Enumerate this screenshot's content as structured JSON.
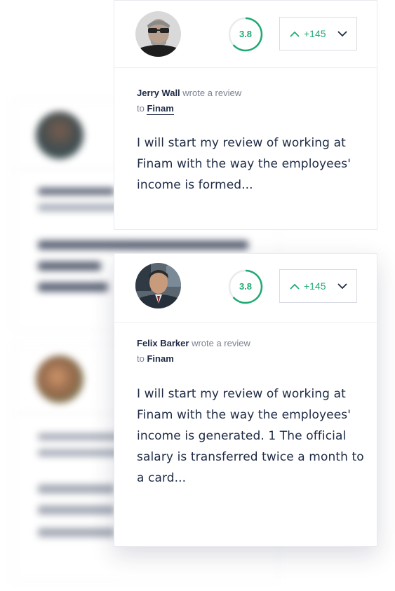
{
  "colors": {
    "accent": "#1faa73",
    "text": "#1d2a44",
    "muted": "#7b8190",
    "border": "#e8eaef"
  },
  "reviews": [
    {
      "author": "Jerry Wall",
      "action": "wrote a review",
      "preposition": "to",
      "company": "Finam",
      "rating": "3.8",
      "votes": "+145",
      "text": "I will start my review of working at Finam with the way the employees' income is formed..."
    },
    {
      "author": "Felix Barker",
      "action": "wrote a review",
      "preposition": "to",
      "company": "Finam",
      "rating": "3.8",
      "votes": "+145",
      "text": "I will start my review of working at Finam with the way the employees' income is generated. 1 The official salary is transferred twice a month to a card..."
    }
  ],
  "icons": {
    "upvote": "chevron-up-icon",
    "downvote": "chevron-down-icon"
  }
}
